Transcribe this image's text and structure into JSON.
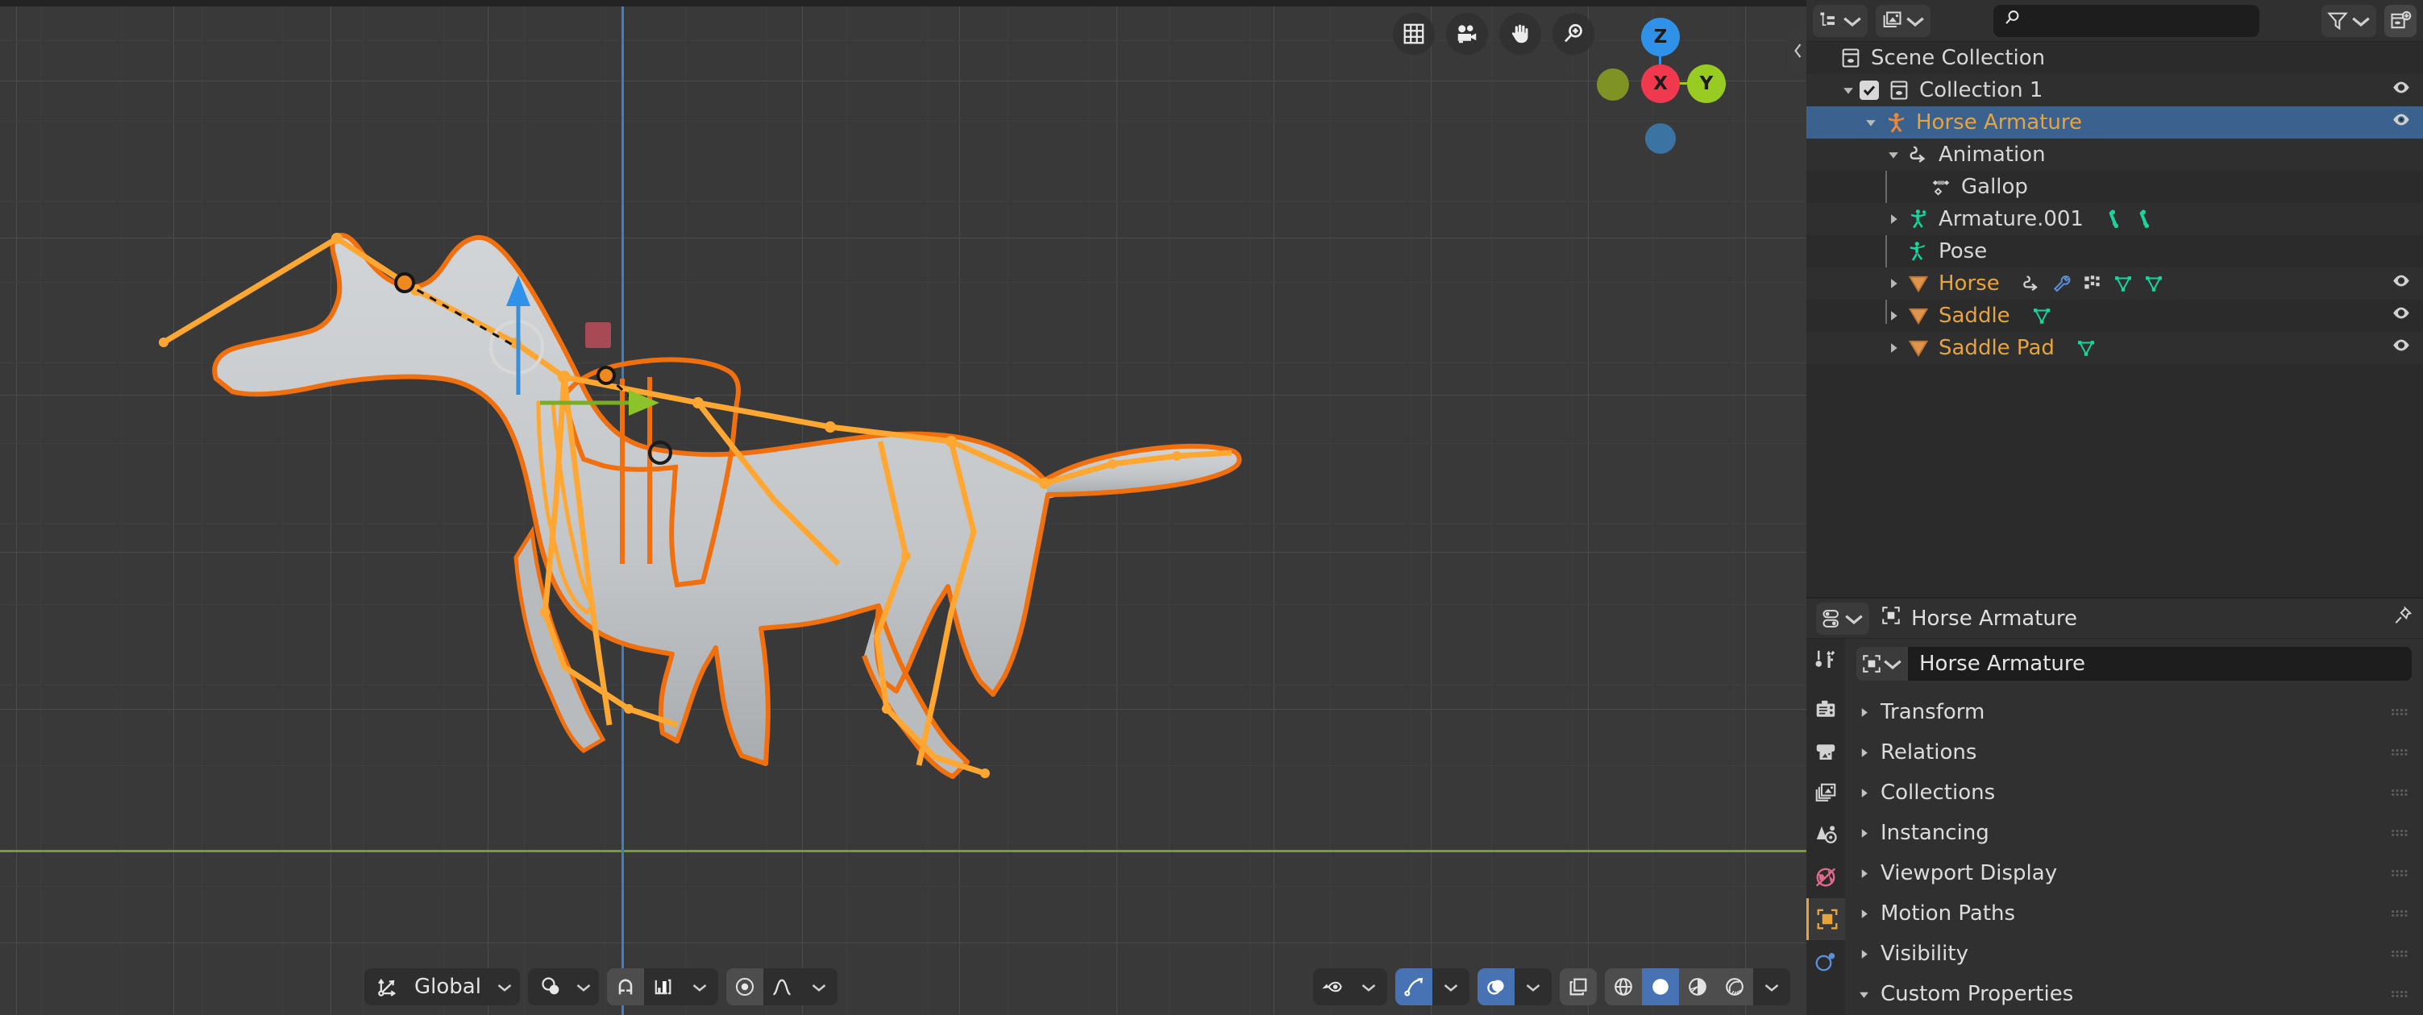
{
  "viewport": {
    "nav_tools": [
      {
        "name": "toggle-xray-grid-icon",
        "label": "Toggle X-Ray"
      },
      {
        "name": "camera-view-icon",
        "label": "Camera View"
      },
      {
        "name": "move-view-hand-icon",
        "label": "Move View"
      },
      {
        "name": "zoom-view-icon",
        "label": "Zoom View"
      }
    ],
    "gizmo": {
      "x_label": "X",
      "y_label": "Y",
      "z_label": "Z",
      "x_color": "#f0384f",
      "y_color": "#99cc22",
      "z_color": "#2f92e8",
      "neg_y_color": "#7f9324",
      "neg_z_color": "#3b74a3"
    },
    "collapse_icon": "chevron-left-icon",
    "footer_left": {
      "orientation_label": "Global",
      "orientation_icon": "transform-orientation-icon",
      "pivot_icon": "pivot-point-icon",
      "snap_magnet_icon": "snap-magnet-icon",
      "snap_to_icon": "snap-increment-icon",
      "proportional_icon": "proportional-editing-icon",
      "falloff_icon": "smooth-falloff-icon"
    },
    "footer_right": {
      "visibility_icon": "object-visibility-icon",
      "gizmo_icon": "show-gizmo-icon",
      "overlays_icon": "show-overlays-icon",
      "xray_icon": "toggle-xray-icon",
      "shading_wireframe_icon": "shading-wireframe-icon",
      "shading_solid_icon": "shading-solid-icon",
      "shading_material_icon": "shading-material-icon",
      "shading_rendered_icon": "shading-rendered-icon"
    },
    "model": {
      "name": "Horse",
      "selection_outline_color": "#f07010",
      "bone_color": "#ffa733",
      "surface_color": "#c6c9cc"
    },
    "grid": {
      "background": "#393939",
      "major_line": "#4b4b4b",
      "y_axis_color": "#7a9b2e",
      "z_axis_color": "#3f7fc1"
    }
  },
  "outliner": {
    "header": {
      "display_mode_icon": "outliner-display-mode-icon",
      "filter_id_icon": "blender-file-id-icon",
      "search_placeholder": "",
      "search_value": "",
      "search_icon": "search-icon",
      "filter_icon": "filter-funnel-icon",
      "new_collection_icon": "new-collection-icon"
    },
    "rows": [
      {
        "label": "Scene Collection",
        "indent": 0,
        "icon": "scene-collection-icon",
        "color": "normal",
        "disclosure": "none",
        "eye": false,
        "selected": false,
        "checkbox": false,
        "extras": []
      },
      {
        "label": "Collection 1",
        "indent": 1,
        "icon": "collection-icon",
        "color": "normal",
        "disclosure": "open",
        "eye": true,
        "selected": false,
        "checkbox": true,
        "extras": []
      },
      {
        "label": "Horse Armature",
        "indent": 2,
        "icon": "armature-object-icon",
        "color": "orange",
        "disclosure": "open",
        "eye": true,
        "selected": true,
        "checkbox": false,
        "extras": []
      },
      {
        "label": "Animation",
        "indent": 3,
        "icon": "animation-icon",
        "color": "normal",
        "disclosure": "open",
        "eye": false,
        "selected": false,
        "checkbox": false,
        "extras": []
      },
      {
        "label": "Gallop",
        "indent": 4,
        "icon": "action-icon",
        "color": "normal",
        "disclosure": "none",
        "eye": false,
        "selected": false,
        "checkbox": false,
        "extras": []
      },
      {
        "label": "Armature.001",
        "indent": 3,
        "icon": "armature-data-icon",
        "color": "normal",
        "disclosure": "closed",
        "eye": false,
        "selected": false,
        "checkbox": false,
        "extras": [
          "bone-icon",
          "bone-icon"
        ]
      },
      {
        "label": "Pose",
        "indent": 3,
        "icon": "pose-icon",
        "color": "normal",
        "disclosure": "none",
        "eye": false,
        "selected": false,
        "checkbox": false,
        "extras": []
      },
      {
        "label": "Horse",
        "indent": 3,
        "icon": "mesh-object-icon",
        "color": "orange",
        "disclosure": "closed",
        "eye": true,
        "selected": false,
        "checkbox": false,
        "extras": [
          "animation-icon",
          "modifier-wrench-icon",
          "vertex-group-icon",
          "mesh-data-icon"
        ]
      },
      {
        "label": "Saddle",
        "indent": 3,
        "icon": "mesh-object-icon",
        "color": "orange",
        "disclosure": "closed",
        "eye": true,
        "selected": false,
        "checkbox": false,
        "extras": [
          "mesh-data-icon"
        ]
      },
      {
        "label": "Saddle Pad",
        "indent": 3,
        "icon": "mesh-object-icon",
        "color": "orange",
        "disclosure": "closed",
        "eye": true,
        "selected": false,
        "checkbox": false,
        "extras": [
          "mesh-data-icon"
        ]
      }
    ]
  },
  "properties": {
    "header": {
      "editor_icon": "properties-editor-icon",
      "breadcrumb_icon": "object-properties-icon",
      "breadcrumb_label": "Horse Armature",
      "pin_icon": "pin-icon"
    },
    "tabs": [
      {
        "name": "tool",
        "icon": "tool-icon",
        "active": false
      },
      {
        "name": "render",
        "icon": "render-camera-icon",
        "active": false
      },
      {
        "name": "output",
        "icon": "output-printer-icon",
        "active": false
      },
      {
        "name": "view-layer",
        "icon": "view-layer-images-icon",
        "active": false
      },
      {
        "name": "scene",
        "icon": "scene-cone-icon",
        "active": false
      },
      {
        "name": "world",
        "icon": "world-globe-icon",
        "active": false
      },
      {
        "name": "object",
        "icon": "object-square-icon",
        "active": true
      },
      {
        "name": "modifiers",
        "icon": "physics-icon",
        "active": false
      }
    ],
    "object_name": {
      "icon": "object-properties-icon",
      "value": "Horse Armature"
    },
    "panels": [
      {
        "label": "Transform",
        "expanded": false
      },
      {
        "label": "Relations",
        "expanded": false
      },
      {
        "label": "Collections",
        "expanded": false
      },
      {
        "label": "Instancing",
        "expanded": false
      },
      {
        "label": "Viewport Display",
        "expanded": false
      },
      {
        "label": "Motion Paths",
        "expanded": false
      },
      {
        "label": "Visibility",
        "expanded": false
      },
      {
        "label": "Custom Properties",
        "expanded": true
      }
    ]
  }
}
